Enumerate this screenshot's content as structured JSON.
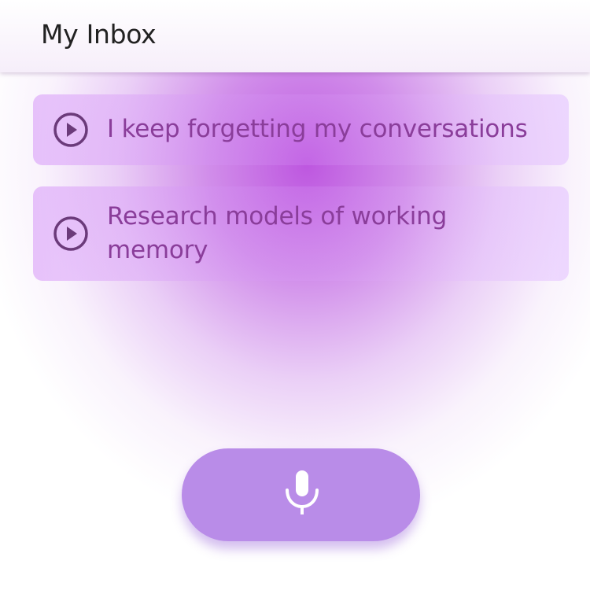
{
  "app_bar": {
    "title": "My Inbox"
  },
  "inbox": {
    "items": [
      {
        "text": "I keep forgetting my conversations",
        "icon": "play-circle-icon"
      },
      {
        "text": "Research models of working memory",
        "icon": "play-circle-icon"
      }
    ]
  },
  "record_button": {
    "icon": "microphone-icon"
  },
  "colors": {
    "accent_purple": "#b98ce8",
    "card_text": "#8a3d9a",
    "icon_dark": "#6b3a7a",
    "glow": "#ba4ede"
  }
}
